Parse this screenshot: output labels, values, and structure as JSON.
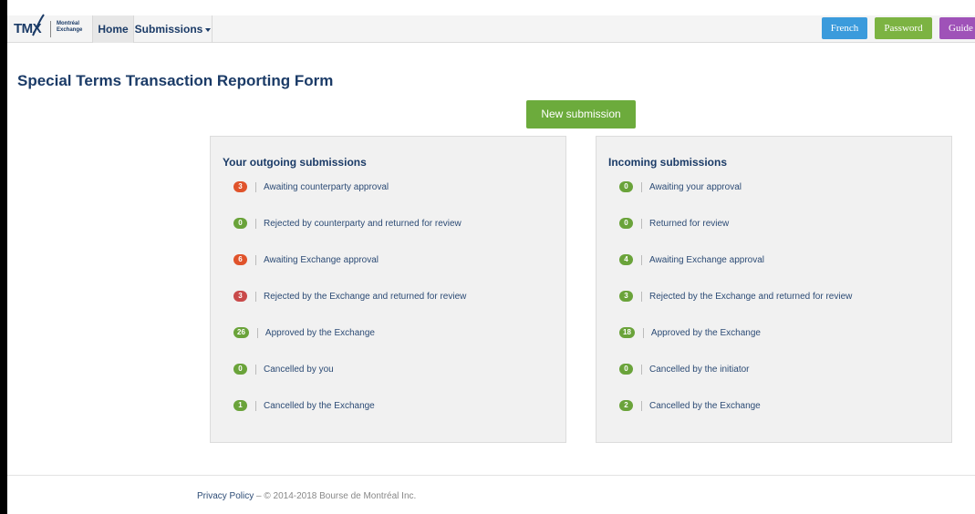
{
  "navbar": {
    "logo": {
      "brand": "TMX",
      "sub_line1": "Montréal",
      "sub_line2": "Exchange"
    },
    "home_label": "Home",
    "submissions_label": "Submissions",
    "buttons": {
      "french": "French",
      "password": "Password",
      "guide": "Guide"
    }
  },
  "page": {
    "title": "Special Terms Transaction Reporting Form",
    "new_submission_label": "New submission"
  },
  "outgoing": {
    "title": "Your outgoing submissions",
    "items": [
      {
        "count": "3",
        "label": "Awaiting counterparty approval",
        "color": "#e0532b"
      },
      {
        "count": "0",
        "label": "Rejected by counterparty and returned for review",
        "color": "#6aa33a"
      },
      {
        "count": "6",
        "label": "Awaiting Exchange approval",
        "color": "#e0532b"
      },
      {
        "count": "3",
        "label": "Rejected by the Exchange and returned for review",
        "color": "#c94a4a"
      },
      {
        "count": "26",
        "label": "Approved by the Exchange",
        "color": "#6aa33a"
      },
      {
        "count": "0",
        "label": "Cancelled by you",
        "color": "#6aa33a"
      },
      {
        "count": "1",
        "label": "Cancelled by the Exchange",
        "color": "#6aa33a"
      }
    ]
  },
  "incoming": {
    "title": "Incoming submissions",
    "items": [
      {
        "count": "0",
        "label": "Awaiting your approval",
        "color": "#6aa33a"
      },
      {
        "count": "0",
        "label": "Returned for review",
        "color": "#6aa33a"
      },
      {
        "count": "4",
        "label": "Awaiting Exchange approval",
        "color": "#6aa33a"
      },
      {
        "count": "3",
        "label": "Rejected by the Exchange and returned for review",
        "color": "#6aa33a"
      },
      {
        "count": "18",
        "label": "Approved by the Exchange",
        "color": "#6aa33a"
      },
      {
        "count": "0",
        "label": "Cancelled by the initiator",
        "color": "#6aa33a"
      },
      {
        "count": "2",
        "label": "Cancelled by the Exchange",
        "color": "#6aa33a"
      }
    ]
  },
  "footer": {
    "privacy_label": "Privacy Policy",
    "copyright": " – © 2014-2018 Bourse de Montréal Inc."
  },
  "colors": {
    "brand_navy": "#1b3b67",
    "french_blue": "#3b9bdc",
    "password_green": "#7cb342",
    "guide_purple": "#9f52b8",
    "new_submission_green": "#6cab3c"
  }
}
